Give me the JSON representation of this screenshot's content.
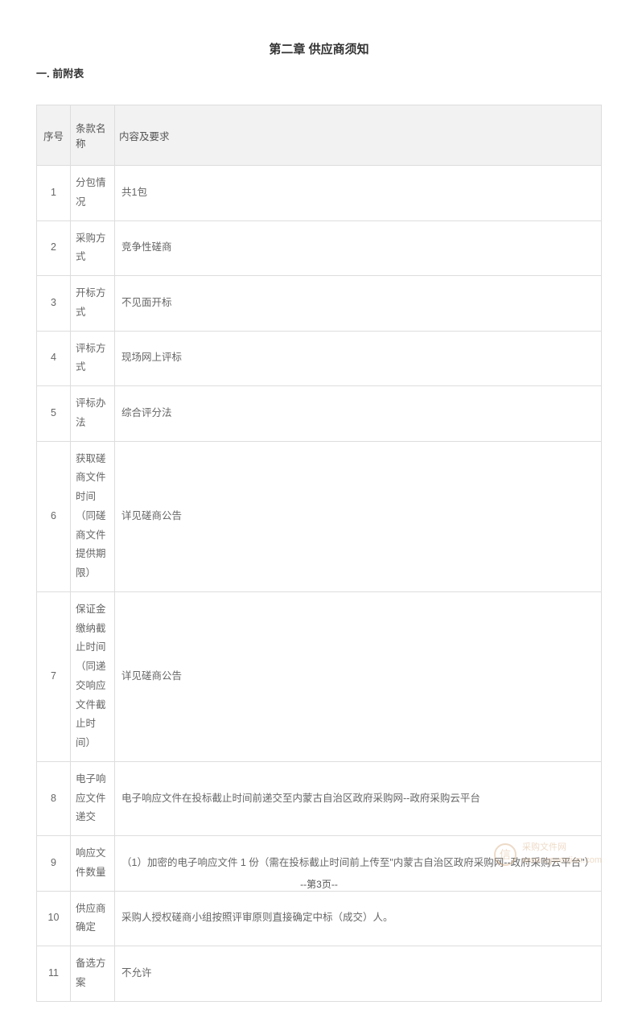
{
  "chapter_title": "第二章 供应商须知",
  "section_title": "一. 前附表",
  "table": {
    "headers": {
      "index": "序号",
      "clause": "条款名称",
      "content": "内容及要求"
    },
    "rows": [
      {
        "index": "1",
        "clause": "分包情况",
        "content": "共1包"
      },
      {
        "index": "2",
        "clause": "采购方式",
        "content": "竞争性磋商"
      },
      {
        "index": "3",
        "clause": "开标方式",
        "content": "不见面开标"
      },
      {
        "index": "4",
        "clause": "评标方式",
        "content": "现场网上评标"
      },
      {
        "index": "5",
        "clause": "评标办法",
        "content": "综合评分法"
      },
      {
        "index": "6",
        "clause": "获取磋商文件时间（同磋商文件提供期限）",
        "content": "详见磋商公告"
      },
      {
        "index": "7",
        "clause": "保证金缴纳截止时间（同递交响应文件截止时间）",
        "content": "详见磋商公告"
      },
      {
        "index": "8",
        "clause": "电子响应文件递交",
        "content": "电子响应文件在投标截止时间前递交至内蒙古自治区政府采购网--政府采购云平台"
      },
      {
        "index": "9",
        "clause": "响应文件数量",
        "content": "（1）加密的电子响应文件 1 份（需在投标截止时间前上传至\"内蒙古自治区政府采购网--政府采购云平台\"）"
      },
      {
        "index": "10",
        "clause": "供应商确定",
        "content": "采购人授权磋商小组按照评审原则直接确定中标（成交）人。"
      },
      {
        "index": "11",
        "clause": "备选方案",
        "content": "不允许"
      }
    ]
  },
  "watermark": {
    "logo": "信",
    "title": "采购文件网",
    "url": "www.cgwenjian.com"
  },
  "page_footer": "--第3页--"
}
